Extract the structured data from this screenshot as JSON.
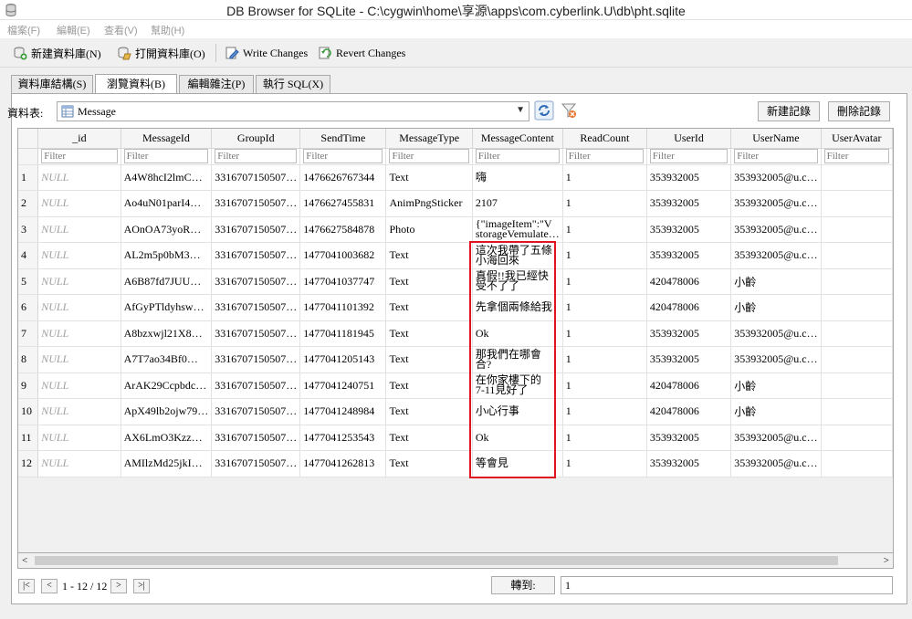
{
  "window": {
    "title": "DB Browser for SQLite - C:\\cygwin\\home\\享源\\apps\\com.cyberlink.U\\db\\pht.sqlite"
  },
  "menu": {
    "items": [
      "檔案(F)",
      "編輯(E)",
      "查看(V)",
      "幫助(H)"
    ]
  },
  "toolbar": {
    "new_db": "新建資料庫(N)",
    "open_db": "打開資料庫(O)",
    "write_changes": "Write Changes",
    "revert_changes": "Revert Changes"
  },
  "tabs": [
    "資料庫結構(S)",
    "瀏覽資料(B)",
    "編輯雜注(P)",
    "執行 SQL(X)"
  ],
  "browse": {
    "table_label": "資料表:",
    "table_selected": "Message",
    "new_record": "新建記錄",
    "delete_record": "刪除記錄"
  },
  "grid": {
    "columns": [
      "_id",
      "MessageId",
      "GroupId",
      "SendTime",
      "MessageType",
      "MessageContent",
      "ReadCount",
      "UserId",
      "UserName",
      "UserAvatar"
    ],
    "filter_placeholder": "Filter",
    "rows": [
      [
        "1",
        "NULL",
        "A4W8hcI2lmC…",
        "3316707150507…",
        "1476626767344",
        "Text",
        "嗨",
        "1",
        "353932005",
        "353932005@u.c…"
      ],
      [
        "2",
        "NULL",
        "Ao4uN01parI4…",
        "3316707150507…",
        "1476627455831",
        "AnimPngSticker",
        "2107",
        "1",
        "353932005",
        "353932005@u.c…"
      ],
      [
        "3",
        "NULL",
        "AOnOA73yoR…",
        "3316707150507…",
        "1476627584878",
        "Photo",
        "{\"imageItem\":\"V\nstorageVemulate…",
        "1",
        "353932005",
        "353932005@u.c…"
      ],
      [
        "4",
        "NULL",
        "AL2m5p0bM3…",
        "3316707150507…",
        "1477041003682",
        "Text",
        "這次我帶了五條\n小海回來",
        "1",
        "353932005",
        "353932005@u.c…"
      ],
      [
        "5",
        "NULL",
        "A6B87fd7JUU…",
        "3316707150507…",
        "1477041037747",
        "Text",
        "真假!!我已經快\n受不了了",
        "1",
        "420478006",
        "小齡"
      ],
      [
        "6",
        "NULL",
        "AfGyPTldyhsw…",
        "3316707150507…",
        "1477041101392",
        "Text",
        "先拿個兩條給我",
        "1",
        "420478006",
        "小齡"
      ],
      [
        "7",
        "NULL",
        "A8bzxwjl21X8…",
        "3316707150507…",
        "1477041181945",
        "Text",
        "Ok",
        "1",
        "353932005",
        "353932005@u.c…"
      ],
      [
        "8",
        "NULL",
        "A7T7ao34Bf0…",
        "3316707150507…",
        "1477041205143",
        "Text",
        "那我們在哪會\n合?",
        "1",
        "353932005",
        "353932005@u.c…"
      ],
      [
        "9",
        "NULL",
        "ArAK29Ccpbdc…",
        "3316707150507…",
        "1477041240751",
        "Text",
        "在你家樓下的\n7-11見好了",
        "1",
        "420478006",
        "小齡"
      ],
      [
        "10",
        "NULL",
        "ApX49lb2ojw79…",
        "3316707150507…",
        "1477041248984",
        "Text",
        "小心行事",
        "1",
        "420478006",
        "小齡"
      ],
      [
        "11",
        "NULL",
        "AX6LmO3Kzz…",
        "3316707150507…",
        "1477041253543",
        "Text",
        "Ok",
        "1",
        "353932005",
        "353932005@u.c…"
      ],
      [
        "12",
        "NULL",
        "AMIlzMd25jkI…",
        "3316707150507…",
        "1477041262813",
        "Text",
        "等會見",
        "1",
        "353932005",
        "353932005@u.c…"
      ]
    ]
  },
  "pager": {
    "first": "|<",
    "prev": "<",
    "status": "1 - 12 / 12",
    "next": ">",
    "last": ">|",
    "goto_label": "轉到:",
    "goto_value": "1"
  },
  "colors": {
    "highlight": "#e0141e"
  }
}
